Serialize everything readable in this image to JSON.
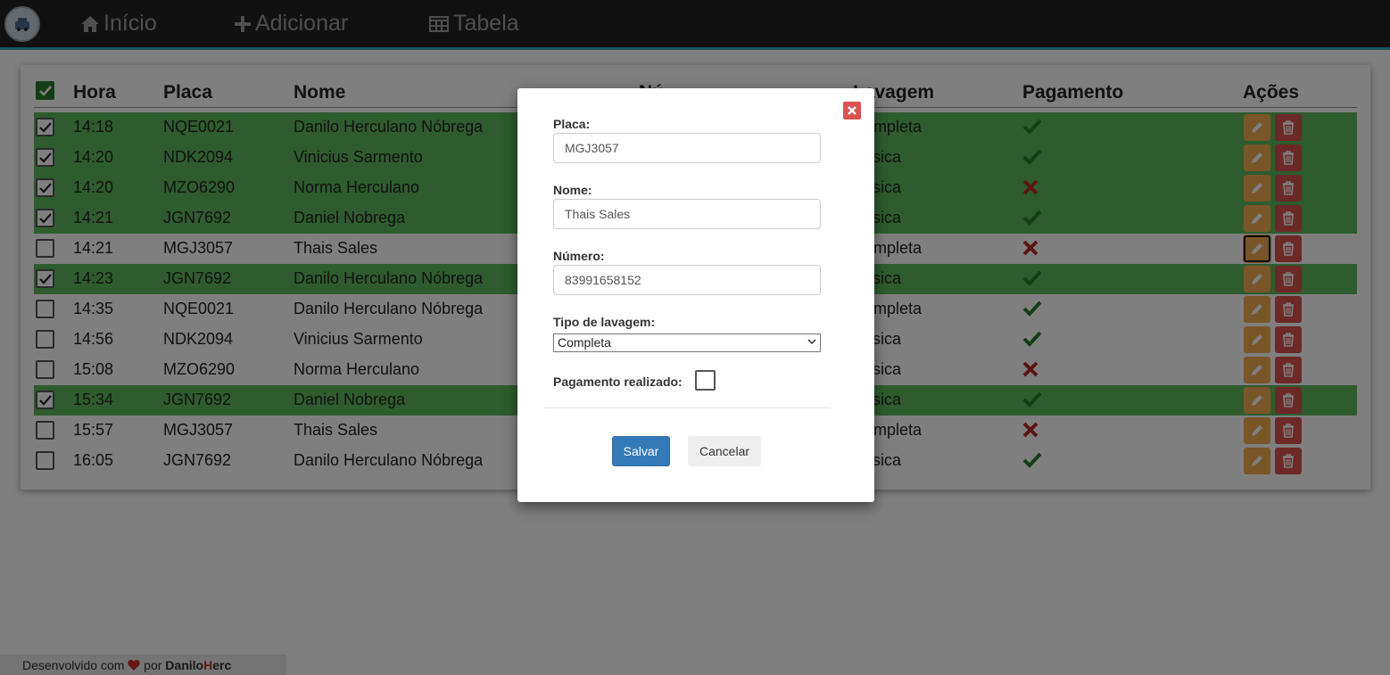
{
  "nav": {
    "items": [
      {
        "label": "Início",
        "icon": "home-icon"
      },
      {
        "label": "Adicionar",
        "icon": "plus-icon"
      },
      {
        "label": "Tabela",
        "icon": "table-icon"
      }
    ],
    "accent": "#2aa5b8"
  },
  "table": {
    "headers": {
      "hora": "Hora",
      "placa": "Placa",
      "nome": "Nome",
      "numero": "Nú",
      "lavagem": "Lavagem",
      "pagamento": "Pagamento",
      "acoes": "Ações"
    },
    "rows": [
      {
        "checked": true,
        "hora": "14:18",
        "placa": "NQE0021",
        "nome": "Danilo Herculano Nóbrega",
        "lavagem": "Completa",
        "pago": true
      },
      {
        "checked": true,
        "hora": "14:20",
        "placa": "NDK2094",
        "nome": "Vinicius Sarmento",
        "lavagem": "Básica",
        "pago": true
      },
      {
        "checked": true,
        "hora": "14:20",
        "placa": "MZO6290",
        "nome": "Norma Herculano",
        "lavagem": "Básica",
        "pago": false
      },
      {
        "checked": true,
        "hora": "14:21",
        "placa": "JGN7692",
        "nome": "Daniel Nobrega",
        "lavagem": "Básica",
        "pago": true
      },
      {
        "checked": false,
        "hora": "14:21",
        "placa": "MGJ3057",
        "nome": "Thais Sales",
        "lavagem": "Completa",
        "pago": false
      },
      {
        "checked": true,
        "hora": "14:23",
        "placa": "JGN7692",
        "nome": "Danilo Herculano Nóbrega",
        "lavagem": "Básica",
        "pago": true
      },
      {
        "checked": false,
        "hora": "14:35",
        "placa": "NQE0021",
        "nome": "Danilo Herculano Nóbrega",
        "lavagem": "Completa",
        "pago": true
      },
      {
        "checked": false,
        "hora": "14:56",
        "placa": "NDK2094",
        "nome": "Vinicius Sarmento",
        "lavagem": "Básica",
        "pago": true
      },
      {
        "checked": false,
        "hora": "15:08",
        "placa": "MZO6290",
        "nome": "Norma Herculano",
        "lavagem": "Básica",
        "pago": false
      },
      {
        "checked": true,
        "hora": "15:34",
        "placa": "JGN7692",
        "nome": "Daniel Nobrega",
        "lavagem": "Básica",
        "pago": true
      },
      {
        "checked": false,
        "hora": "15:57",
        "placa": "MGJ3057",
        "nome": "Thais Sales",
        "lavagem": "Completa",
        "pago": false
      },
      {
        "checked": false,
        "hora": "16:05",
        "placa": "JGN7692",
        "nome": "Danilo Herculano Nóbrega",
        "lavagem": "Básica",
        "pago": true
      }
    ],
    "colors": {
      "paid_row": "#5cb85c",
      "check": "#2b7a2b",
      "cross": "#b52b27",
      "edit": "#f0ad4e",
      "delete": "#d9534f"
    }
  },
  "modal": {
    "placa_label": "Placa:",
    "placa_value": "MGJ3057",
    "nome_label": "Nome:",
    "nome_value": "Thais Sales",
    "numero_label": "Número:",
    "numero_value": "83991658152",
    "tipo_label": "Tipo de lavagem:",
    "tipo_value": "Completa",
    "pagamento_label": "Pagamento realizado:",
    "pagamento_checked": false,
    "save_label": "Salvar",
    "cancel_label": "Cancelar"
  },
  "footer": {
    "prefix": "Desenvolvido com",
    "por": "por",
    "brand_a": "Danilo",
    "brand_b": "H",
    "brand_c": "erc"
  }
}
